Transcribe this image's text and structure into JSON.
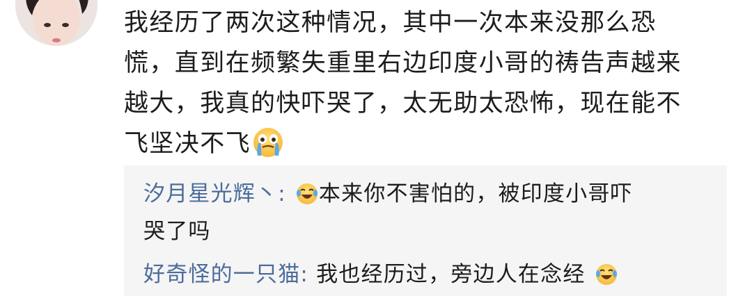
{
  "comment": {
    "avatar_icon": "avatar",
    "lines": [
      "我经历了两次这种情况，其中一次本来没那么恐",
      "慌，直到在频繁失重里右边印度小哥的祷告声越来",
      "越大，我真的快吓哭了，太无助太恐怖，现在能不",
      "飞坚决不飞"
    ],
    "trailing_emoji": "crying-face-emoji"
  },
  "replies": [
    {
      "username": "汐月星光辉丶",
      "colon": ":",
      "emoji": "laugh-cry-emoji",
      "text_line1": "本来你不害怕的，被印度小哥吓",
      "text_line2": "哭了吗"
    },
    {
      "username": "好奇怪的一只猫",
      "colon": ":",
      "text": " 我也经历过，旁边人在念经",
      "emoji": "laugh-cry-emoji"
    }
  ],
  "colors": {
    "username": "#4b6c9b",
    "text": "#1c1c1c",
    "reply_background": "#f5f5f5"
  }
}
